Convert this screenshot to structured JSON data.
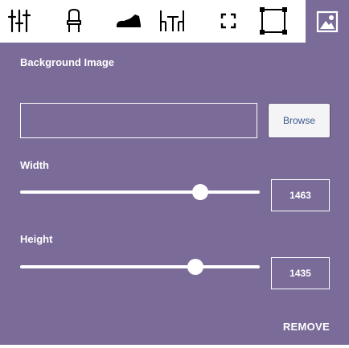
{
  "toolbar": {
    "icons": [
      "tools-icon",
      "chair-icon",
      "shoe-icon",
      "table-chairs-icon",
      "expand-icon",
      "frame-icon",
      "image-icon"
    ],
    "active": "image-icon"
  },
  "panel": {
    "title": "Background Image",
    "file_input_value": "",
    "browse_label": "Browse",
    "width": {
      "label": "Width",
      "value": "1463",
      "slider_fraction": 0.75
    },
    "height": {
      "label": "Height",
      "value": "1435",
      "slider_fraction": 0.73
    },
    "remove_label": "REMOVE"
  },
  "colors": {
    "panel_bg": "#7a6b98",
    "toolbar_bg": "#ffffff",
    "text": "#ffffff",
    "browse_text": "#3a5a8c"
  }
}
